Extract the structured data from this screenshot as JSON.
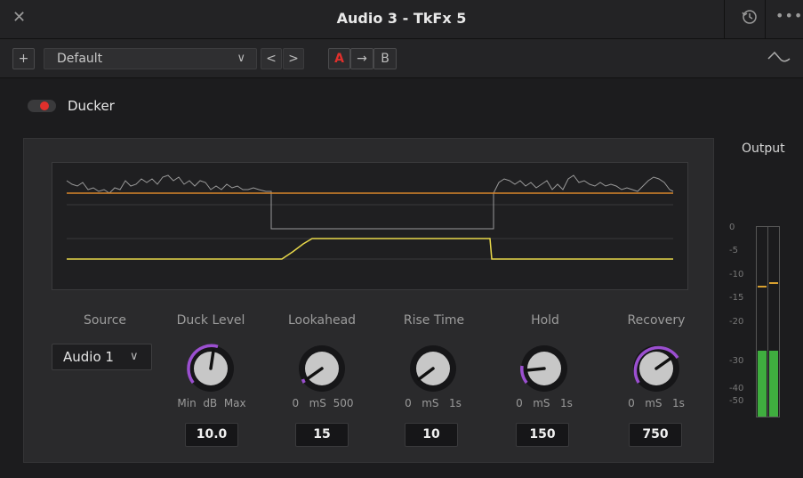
{
  "window": {
    "title": "Audio 3 - TkFx 5"
  },
  "toolbar": {
    "add_label": "+",
    "preset_label": "Default",
    "prev_label": "<",
    "next_label": ">",
    "a_label": "A",
    "arrow_label": "→",
    "b_label": "B"
  },
  "ducker": {
    "label": "Ducker",
    "enabled": true
  },
  "controls": {
    "source": {
      "label": "Source",
      "value": "Audio 1"
    },
    "duck_level": {
      "label": "Duck Level",
      "min": "Min",
      "unit": "dB",
      "max": "Max",
      "value": "10.0"
    },
    "lookahead": {
      "label": "Lookahead",
      "min": "0",
      "unit": "mS",
      "max": "500",
      "value": "15"
    },
    "rise_time": {
      "label": "Rise Time",
      "min": "0",
      "unit": "mS",
      "max": "1s",
      "value": "10"
    },
    "hold": {
      "label": "Hold",
      "min": "0",
      "unit": "mS",
      "max": "1s",
      "value": "150"
    },
    "recovery": {
      "label": "Recovery",
      "min": "0",
      "unit": "mS",
      "max": "1s",
      "value": "750"
    }
  },
  "output": {
    "label": "Output",
    "scale": [
      "0",
      "-5",
      "-10",
      "-15",
      "-20",
      "-30",
      "-40",
      "-50"
    ]
  },
  "colors": {
    "accent": "#e0302c",
    "knob_arc": "#9b4fd0",
    "envelope": "#e8d84a",
    "threshold": "#d8862a",
    "meter": "#3fae3f"
  }
}
